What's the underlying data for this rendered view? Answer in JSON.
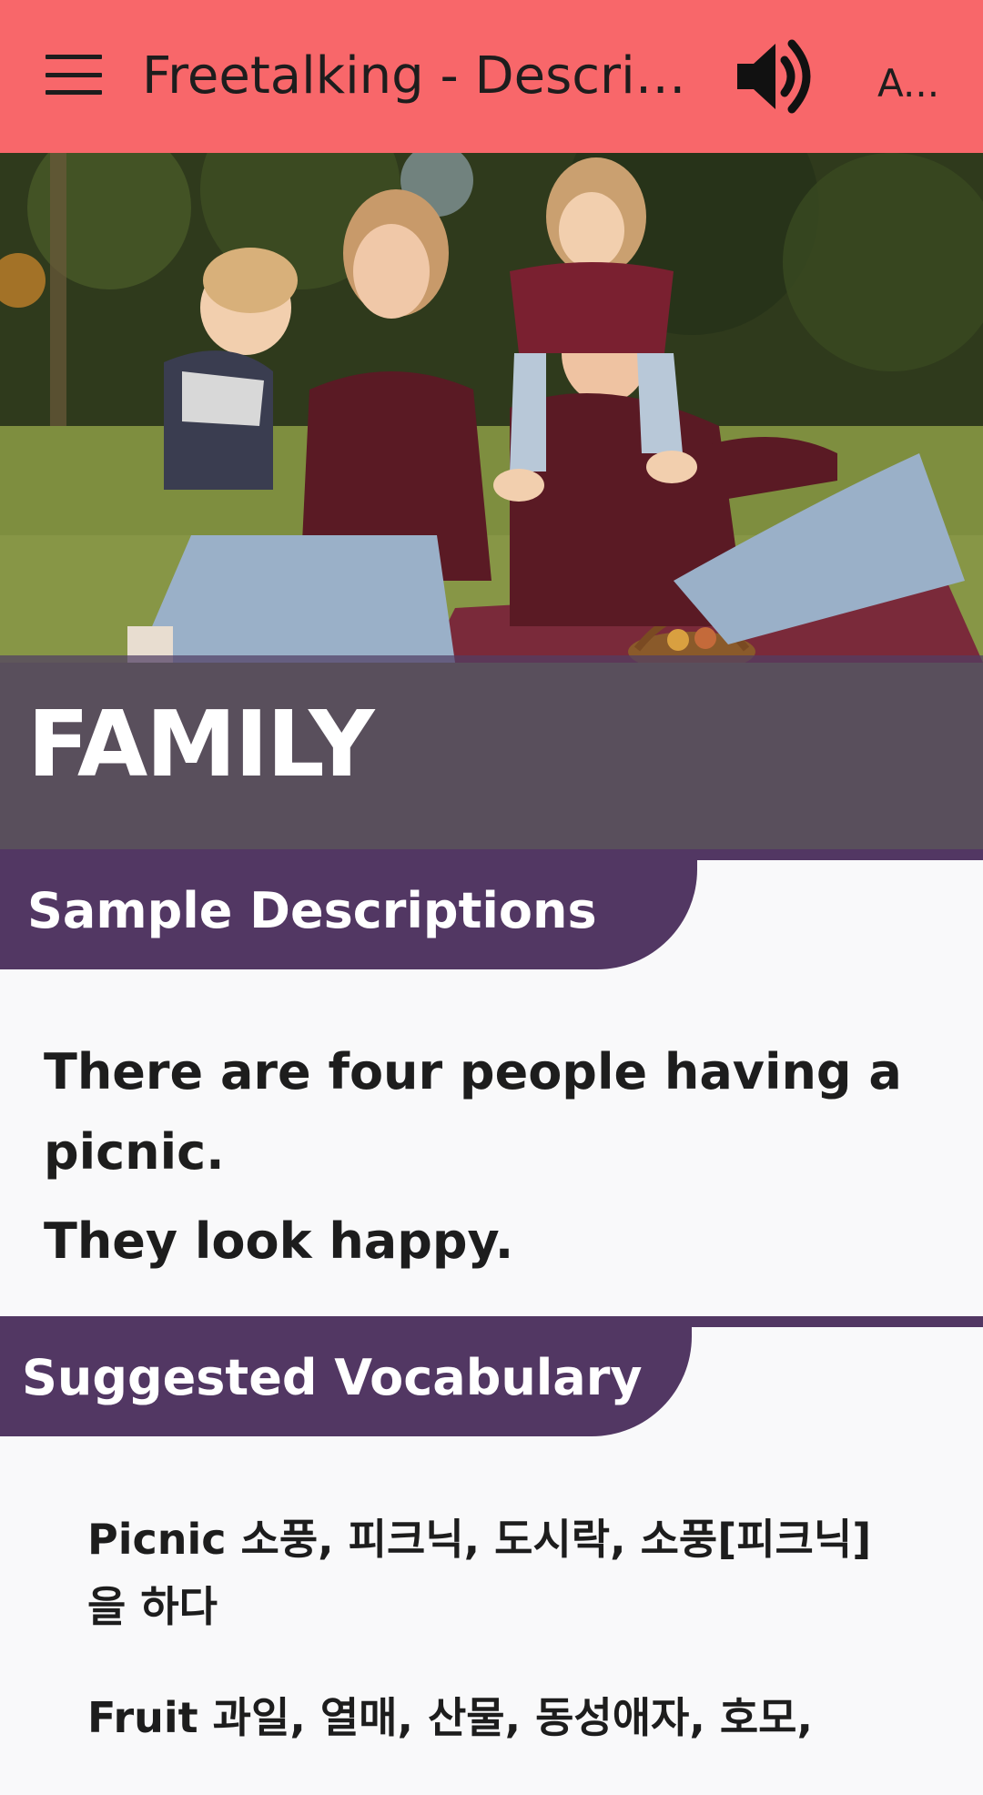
{
  "appbar": {
    "title": "Freetalking - Description",
    "action_label": "A...",
    "menu_icon": "hamburger-menu-icon",
    "speaker_icon": "volume-icon"
  },
  "hero": {
    "title": "FAMILY",
    "image_alt": "Family of four having a picnic on the grass"
  },
  "sections": {
    "sample": {
      "header": "Sample Descriptions",
      "lines": [
        "There are four people having a picnic.",
        "They look happy."
      ]
    },
    "vocab": {
      "header": "Suggested Vocabulary",
      "items": [
        "Picnic 소풍, 피크닉, 도시락, 소풍[피크닉]을 하다",
        "Fruit 과일, 열매, 산물, 동성애자, 호모,"
      ]
    }
  },
  "colors": {
    "appbar": "#f8676a",
    "accent": "#523763",
    "background": "#f9f9fa",
    "text": "#1d1d1d"
  }
}
